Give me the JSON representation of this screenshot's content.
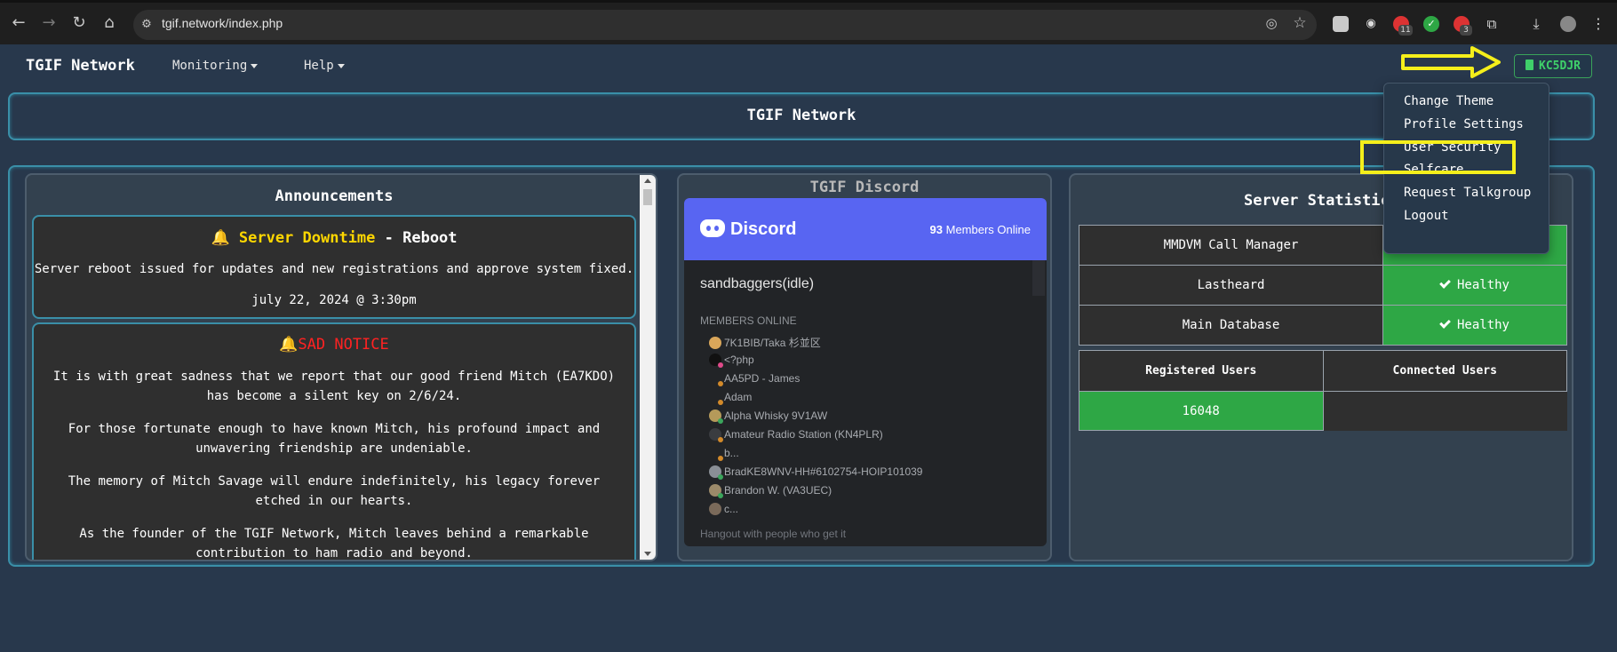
{
  "browser": {
    "url": "tgif.network/index.php",
    "badges": {
      "calendar": "11",
      "notif": "3"
    }
  },
  "navbar": {
    "brand": "TGIF Network",
    "menus": [
      "Monitoring",
      "Help"
    ],
    "user": "KC5DJR"
  },
  "title_panel": {
    "title": "TGIF Network"
  },
  "user_menu": {
    "items": [
      "Change Theme",
      "Profile Settings",
      "User Security",
      "Selfcare",
      "Request Talkgroup",
      "Logout"
    ]
  },
  "announcements": {
    "heading": "Announcements",
    "item1": {
      "title_highlight": "Server Downtime",
      "title_rest": " - Reboot",
      "body": "Server reboot issued for updates and new registrations and approve system fixed.",
      "date": "july 22, 2024 @ 3:30pm"
    },
    "item2": {
      "title": "SAD NOTICE",
      "paragraphs": [
        "It is with great sadness that we report that our good friend Mitch (EA7KDO) has become a silent key on 2/6/24.",
        "For those fortunate enough to have known Mitch, his profound impact and unwavering friendship are undeniable.",
        "The memory of Mitch Savage will endure indefinitely, his legacy forever etched in our hearts.",
        "As the founder of the TGIF Network, Mitch leaves behind a remarkable contribution to ham radio and beyond."
      ]
    }
  },
  "discord": {
    "heading": "TGIF Discord",
    "logo_text": "Discord",
    "online_count": "93",
    "online_label": " Members Online",
    "channel": "sandbaggers(idle)",
    "section": "MEMBERS ONLINE",
    "members": [
      "7K1BIB/Taka 杉並区",
      "<?php",
      "AA5PD - James",
      "Adam",
      "Alpha Whisky 9V1AW",
      "Amateur Radio Station (KN4PLR)",
      "b...",
      "BradKE8WNV-HH#6102754-HOIP101039",
      "Brandon W. (VA3UEC)",
      "c..."
    ],
    "footer": "Hangout with people who get it"
  },
  "stats": {
    "heading": "Server Statistics",
    "services": [
      {
        "name": "MMDVM Call Manager",
        "status": ""
      },
      {
        "name": "Lastheard",
        "status": "Healthy"
      },
      {
        "name": "Main Database",
        "status": "Healthy"
      }
    ],
    "registered_label": "Registered Users",
    "connected_label": "Connected Users",
    "registered_value": "16048",
    "connected_value": ""
  },
  "colors": {
    "accent_border": "#3a8fa8",
    "healthy": "#2ea745",
    "annotation": "#f5ef1b"
  }
}
